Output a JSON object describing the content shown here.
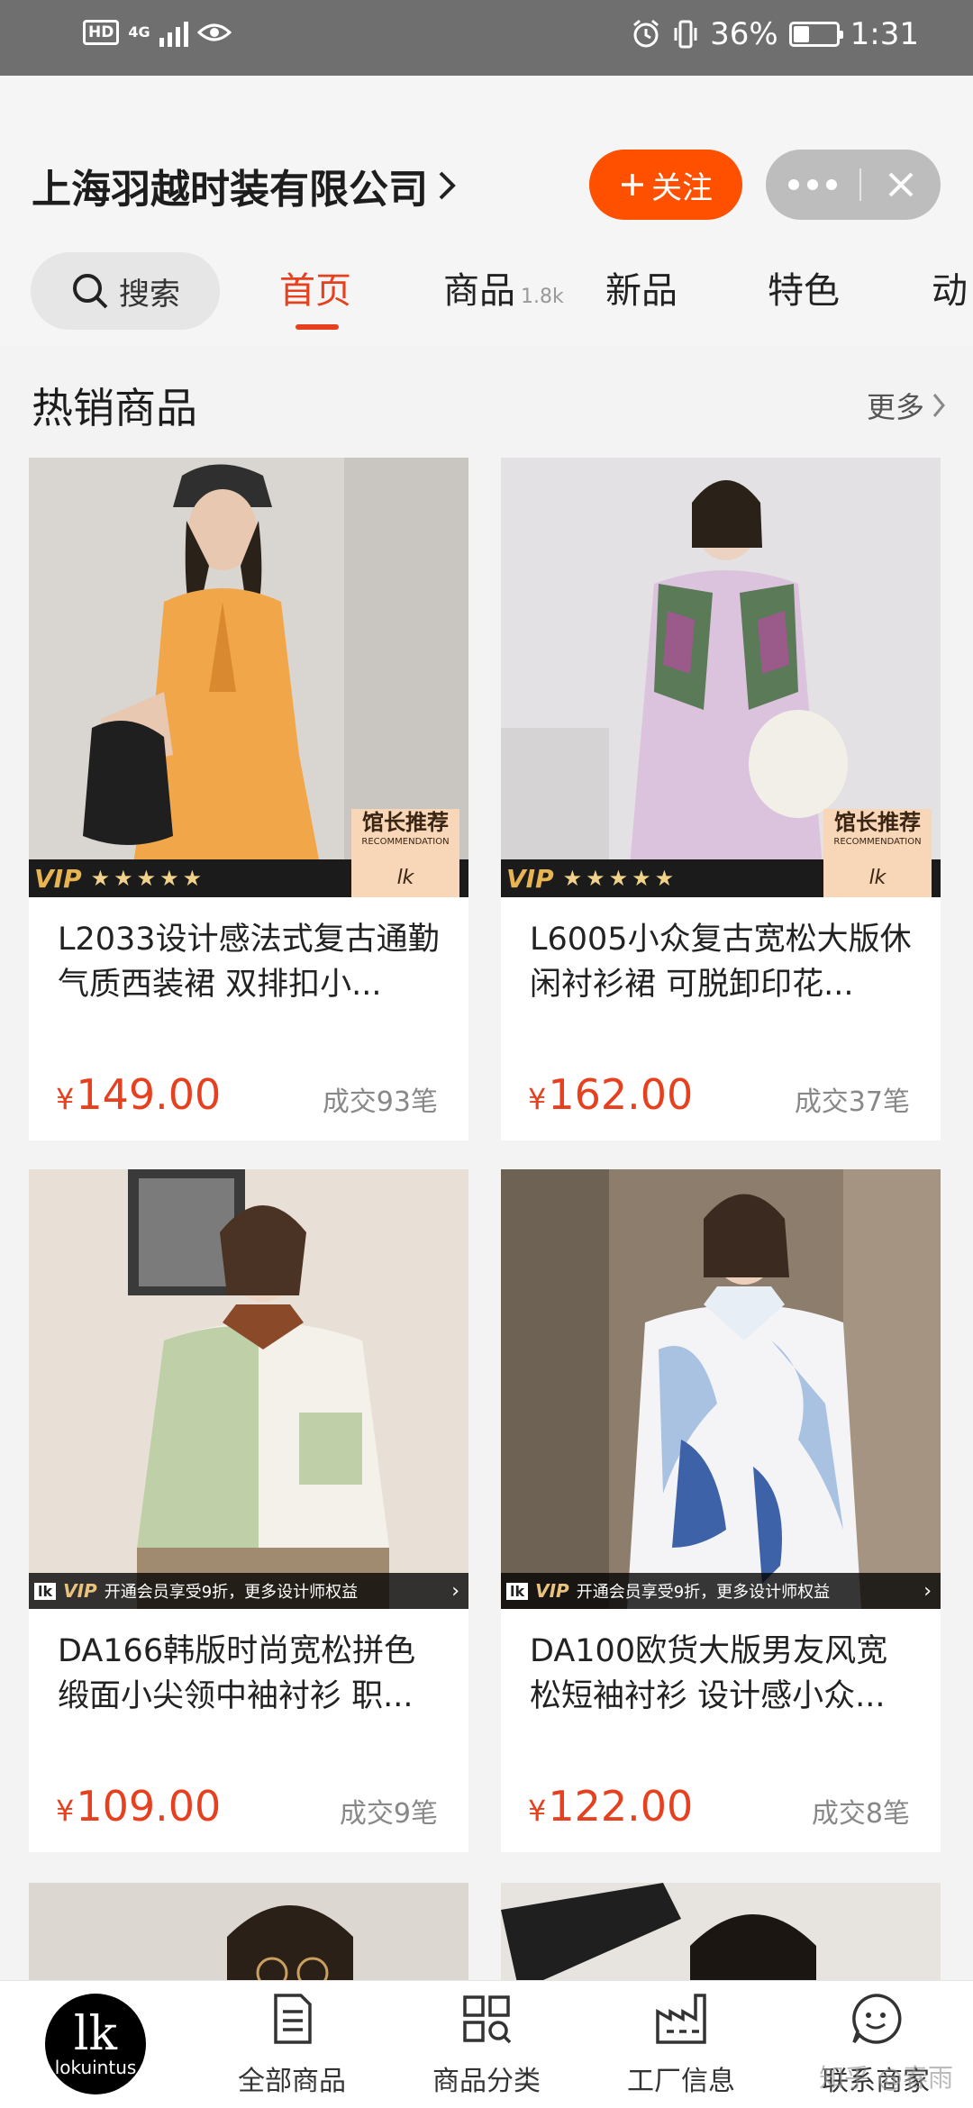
{
  "status_bar": {
    "hd": "HD",
    "network": "4G",
    "battery_text": "36%",
    "battery_level": 0.36,
    "time": "1:31"
  },
  "header": {
    "shop_name": "上海羽越时装有限公司",
    "follow_label": "关注",
    "search_label": "搜索",
    "tabs": [
      {
        "label": "首页",
        "count": "",
        "active": true
      },
      {
        "label": "商品",
        "count": "1.8k",
        "active": false
      },
      {
        "label": "新品",
        "count": "",
        "active": false
      },
      {
        "label": "特色",
        "count": "",
        "active": false
      },
      {
        "label": "动",
        "count": "",
        "active": false
      }
    ]
  },
  "section": {
    "title": "热销商品",
    "more_label": "更多"
  },
  "products": [
    {
      "title": "L2033设计感法式复古通勤气质西装裙 双排扣小...",
      "currency": "¥",
      "price": "149.00",
      "sold": "成交93笔",
      "badge": "recommend",
      "img_bg": "#d9d6d2",
      "garment_color": "#f2a64a"
    },
    {
      "title": "L6005小众复古宽松大版休闲衬衫裙 可脱卸印花...",
      "currency": "¥",
      "price": "162.00",
      "sold": "成交37笔",
      "badge": "recommend",
      "img_bg": "#e3e1e3",
      "garment_color": "#dcc3dd"
    },
    {
      "title": "DA166韩版时尚宽松拼色缎面小尖领中袖衬衫 职...",
      "currency": "¥",
      "price": "109.00",
      "sold": "成交9笔",
      "badge": "vip-bar",
      "img_bg": "#e8e0d6",
      "garment_color": "#bfd0a8"
    },
    {
      "title": "DA100欧货大版男友风宽松短袖衬衫 设计感小众...",
      "currency": "¥",
      "price": "122.00",
      "sold": "成交8笔",
      "badge": "vip-bar",
      "img_bg": "#8d7d6c",
      "garment_color": "#a9c2e2"
    }
  ],
  "badges": {
    "vip": "VIP",
    "stars": "★★★★★",
    "recommend_zh": "馆长推荐",
    "recommend_en": "RECOMMENDATION",
    "lk": "lk",
    "vip_bar_text": "开通会员享受9折，更多设计师权益"
  },
  "bottom_nav": {
    "logo_text": "lk",
    "logo_brand": "lokuintus",
    "items": [
      {
        "label": "全部商品",
        "icon": "document-icon"
      },
      {
        "label": "商品分类",
        "icon": "grid-icon"
      },
      {
        "label": "工厂信息",
        "icon": "factory-icon"
      },
      {
        "label": "联系商家",
        "icon": "chat-face-icon"
      }
    ]
  },
  "watermark": "知乎 @春雨",
  "colors": {
    "accent": "#e7401f",
    "follow": "#ff5000",
    "status_bar": "#6f6f6f"
  }
}
